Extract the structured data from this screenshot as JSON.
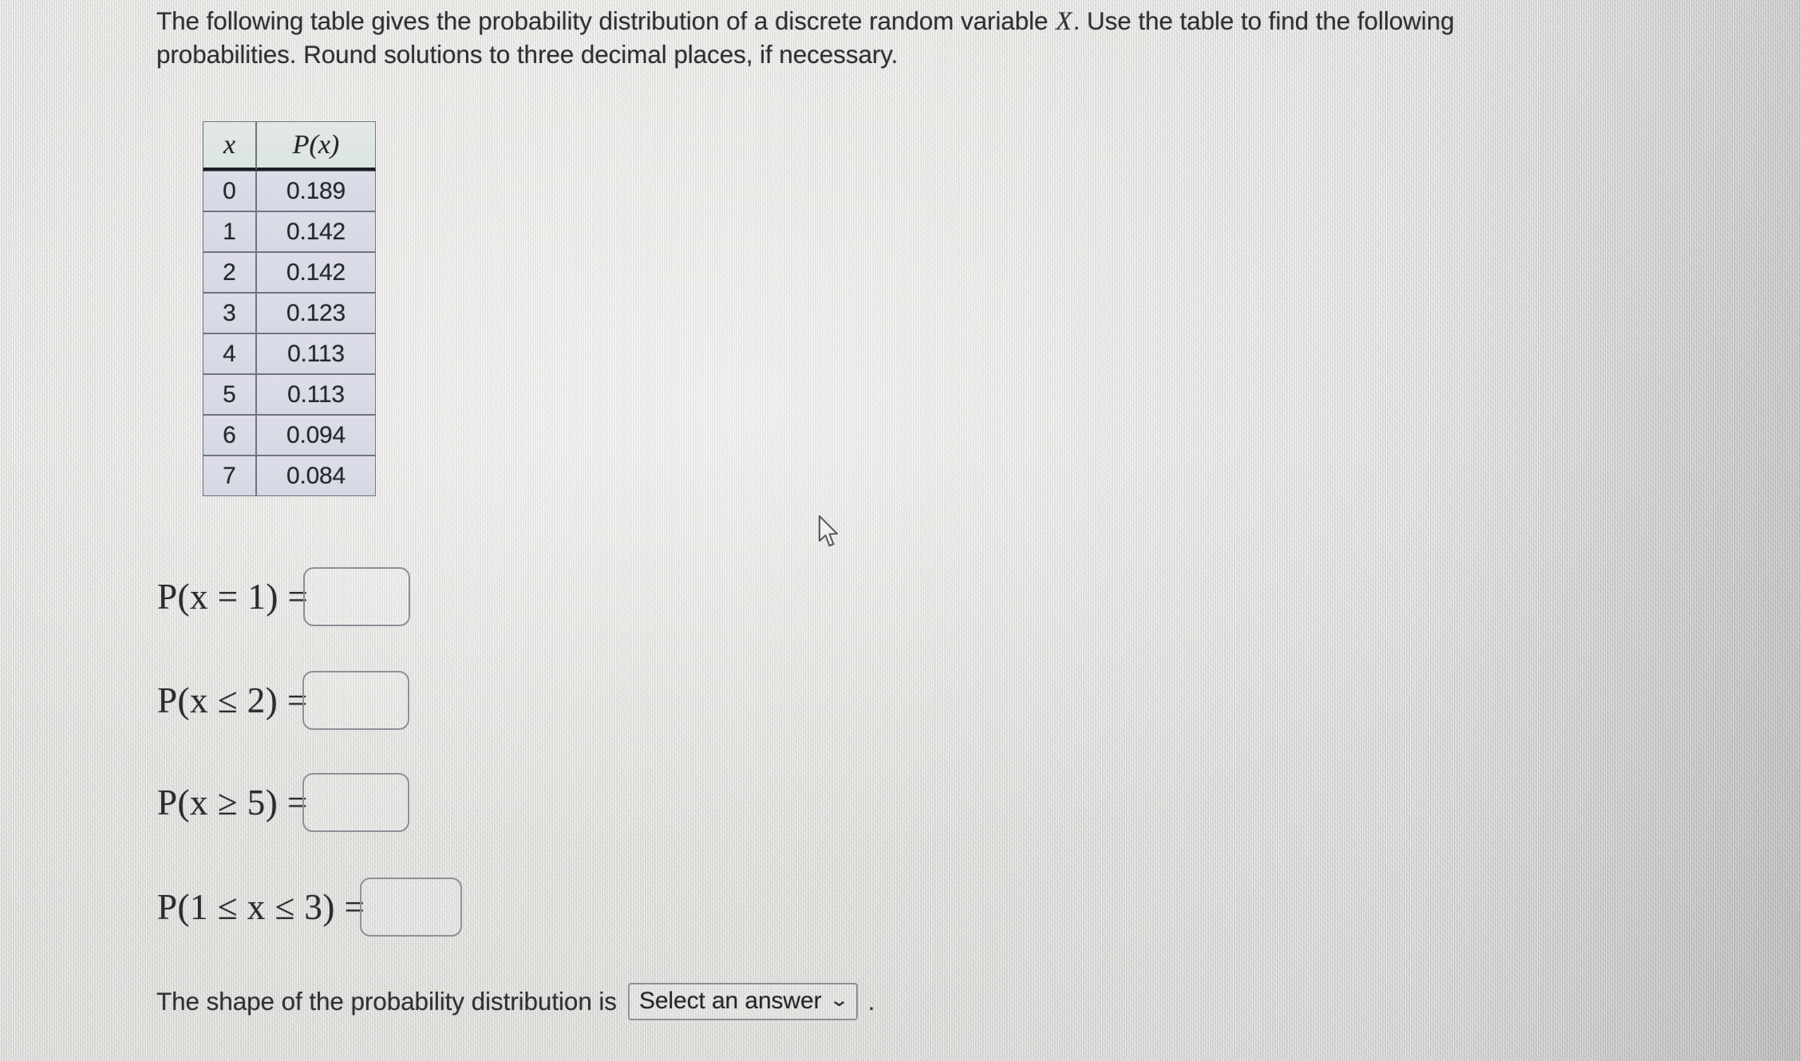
{
  "prompt": {
    "line1_before_var": "The following table gives the probability distribution of a discrete random variable ",
    "variable": "X",
    "line1_after_var": ". Use the table to find the following probabilities. Round solutions to three decimal places, if necessary."
  },
  "table": {
    "headers": [
      "x",
      "P(x)"
    ],
    "rows": [
      {
        "x": "0",
        "px": "0.189"
      },
      {
        "x": "1",
        "px": "0.142"
      },
      {
        "x": "2",
        "px": "0.142"
      },
      {
        "x": "3",
        "px": "0.123"
      },
      {
        "x": "4",
        "px": "0.113"
      },
      {
        "x": "5",
        "px": "0.113"
      },
      {
        "x": "6",
        "px": "0.094"
      },
      {
        "x": "7",
        "px": "0.084"
      }
    ]
  },
  "questions": [
    {
      "label": "P(x = 1) =",
      "value": ""
    },
    {
      "label": "P(x ≤ 2) =",
      "value": ""
    },
    {
      "label": "P(x ≥ 5) =",
      "value": ""
    },
    {
      "label": "P(1 ≤ x ≤ 3) =",
      "value": ""
    }
  ],
  "shape": {
    "text": "The shape of the probability distribution is",
    "select_value": "Select an answer",
    "caret": "⌄",
    "period": "."
  },
  "chart_data": {
    "type": "table",
    "title": "Probability distribution of discrete random variable X",
    "categories": [
      "0",
      "1",
      "2",
      "3",
      "4",
      "5",
      "6",
      "7"
    ],
    "values": [
      0.189,
      0.142,
      0.142,
      0.123,
      0.113,
      0.113,
      0.094,
      0.084
    ],
    "xlabel": "x",
    "ylabel": "P(x)",
    "ylim": [
      0,
      0.2
    ],
    "grid": false,
    "legend": "none"
  },
  "colors": {
    "header_fill": "#dde5e1",
    "row_fill": "#d8dae5",
    "border": "#6f7480",
    "text": "#2a2c30",
    "background": "#e9e7e3"
  }
}
